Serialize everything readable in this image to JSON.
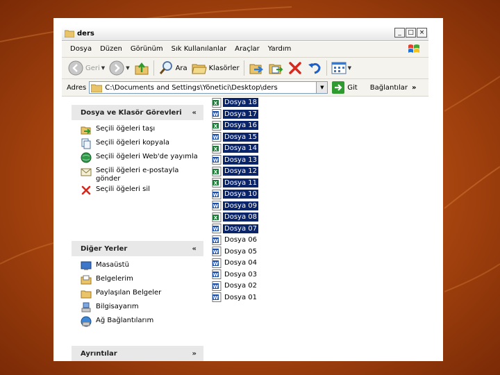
{
  "window": {
    "title": "ders",
    "controls": {
      "minimize": "_",
      "maximize": "□",
      "close": "×"
    }
  },
  "menu": [
    "Dosya",
    "Düzen",
    "Görünüm",
    "Sık Kullanılanlar",
    "Araçlar",
    "Yardım"
  ],
  "toolbar": {
    "back_label": "Geri",
    "search_label": "Ara",
    "folders_label": "Klasörler"
  },
  "address": {
    "label": "Adres",
    "path": "C:\\Documents and Settings\\Yönetici\\Desktop\\ders",
    "go_label": "Git",
    "links_label": "Bağlantılar",
    "links_chevron": "»"
  },
  "panels": {
    "tasks": {
      "title": "Dosya ve Klasör Görevleri",
      "chevron": "«",
      "items": [
        {
          "label": "Seçili öğeleri taşı",
          "icon": "move-icon"
        },
        {
          "label": "Seçili öğeleri kopyala",
          "icon": "copy-icon"
        },
        {
          "label": "Seçili öğeleri Web'de yayımla",
          "icon": "web-publish-icon"
        },
        {
          "label": "Seçili öğeleri e-postayla gönder",
          "icon": "email-icon"
        },
        {
          "label": "Seçili öğeleri sil",
          "icon": "delete-icon"
        }
      ]
    },
    "places": {
      "title": "Diğer Yerler",
      "chevron": "«",
      "items": [
        {
          "label": "Masaüstü",
          "icon": "desktop-icon"
        },
        {
          "label": "Belgelerim",
          "icon": "my-documents-icon"
        },
        {
          "label": "Paylaşılan Belgeler",
          "icon": "shared-folder-icon"
        },
        {
          "label": "Bilgisayarım",
          "icon": "my-computer-icon"
        },
        {
          "label": "Ağ Bağlantılarım",
          "icon": "network-icon"
        }
      ]
    },
    "details": {
      "title": "Ayrıntılar",
      "chevron": "»"
    }
  },
  "files": [
    {
      "name": "Dosya 18",
      "type": "excel",
      "selected": true
    },
    {
      "name": "Dosya 17",
      "type": "word",
      "selected": true
    },
    {
      "name": "Dosya 16",
      "type": "excel",
      "selected": true
    },
    {
      "name": "Dosya 15",
      "type": "word",
      "selected": true
    },
    {
      "name": "Dosya 14",
      "type": "excel",
      "selected": true
    },
    {
      "name": "Dosya 13",
      "type": "word",
      "selected": true
    },
    {
      "name": "Dosya 12",
      "type": "excel",
      "selected": true
    },
    {
      "name": "Dosya 11",
      "type": "excel",
      "selected": true
    },
    {
      "name": "Dosya 10",
      "type": "word",
      "selected": true
    },
    {
      "name": "Dosya 09",
      "type": "word",
      "selected": true
    },
    {
      "name": "Dosya 08",
      "type": "excel",
      "selected": true
    },
    {
      "name": "Dosya 07",
      "type": "word",
      "selected": true
    },
    {
      "name": "Dosya 06",
      "type": "word",
      "selected": false
    },
    {
      "name": "Dosya 05",
      "type": "word",
      "selected": false
    },
    {
      "name": "Dosya 04",
      "type": "word",
      "selected": false
    },
    {
      "name": "Dosya 03",
      "type": "word",
      "selected": false
    },
    {
      "name": "Dosya 02",
      "type": "word",
      "selected": false
    },
    {
      "name": "Dosya 01",
      "type": "word",
      "selected": false
    }
  ],
  "colors": {
    "selection": "#0a246a",
    "slide_background": "#b5541a"
  }
}
